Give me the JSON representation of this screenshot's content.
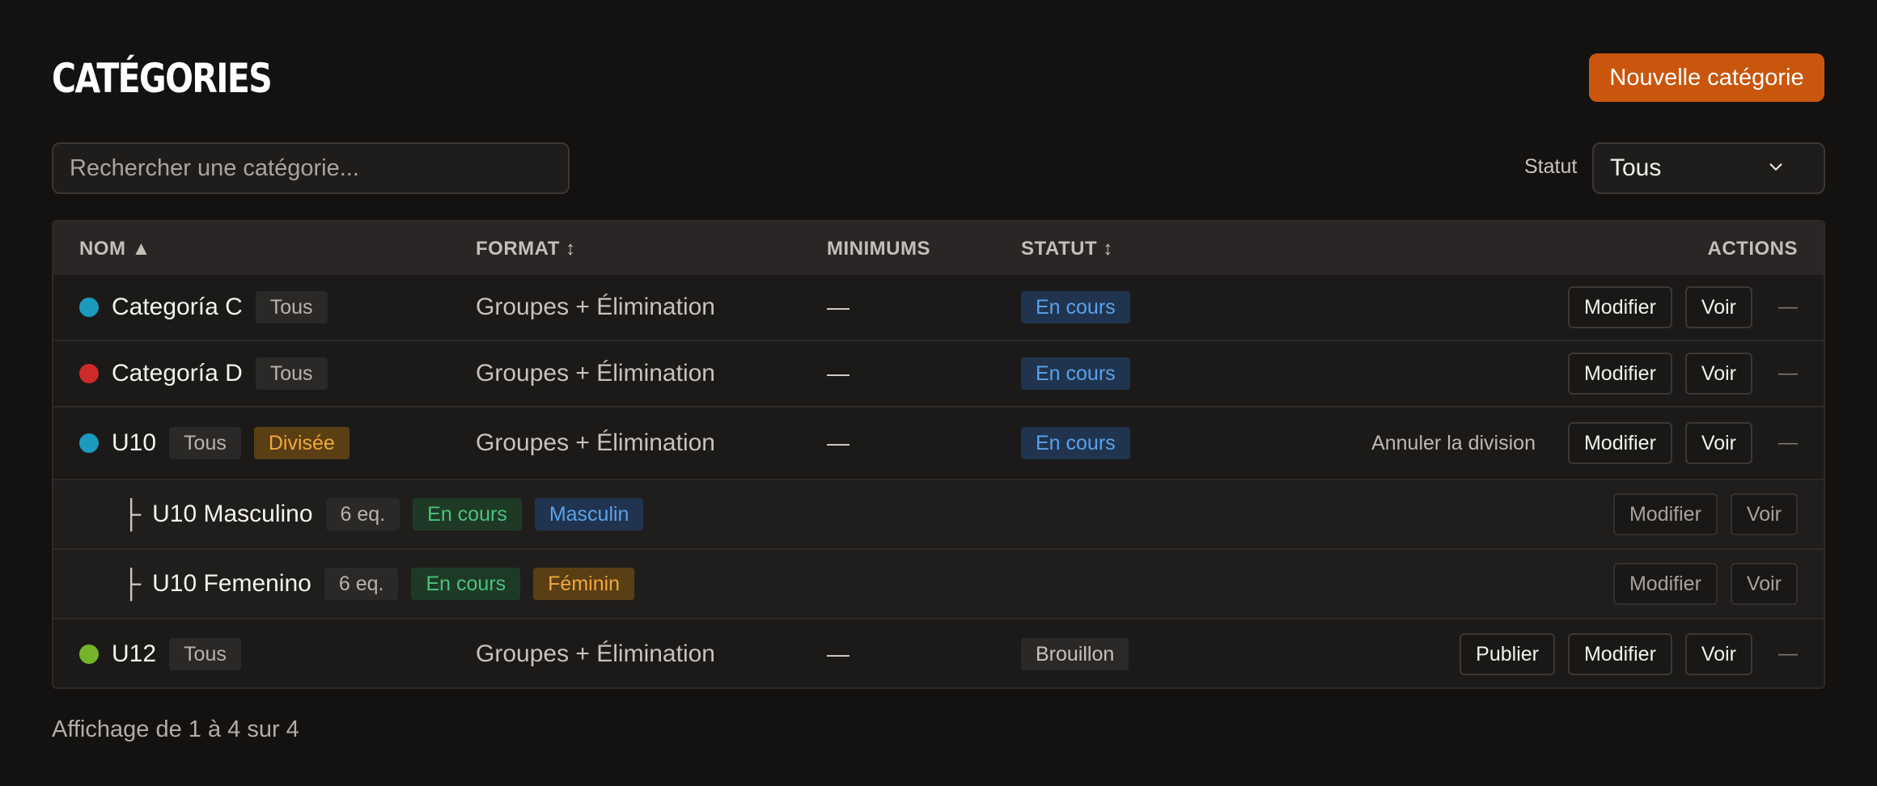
{
  "page": {
    "title": "CATÉGORIES",
    "new_button": "Nouvelle catégorie",
    "search_placeholder": "Rechercher une catégorie...",
    "status_label": "Statut",
    "status_value": "Tous"
  },
  "table": {
    "headers": {
      "name": "NOM ▲",
      "format": "FORMAT ↕",
      "minimums": "MINIMUMS",
      "status": "STATUT ↕",
      "actions": "ACTIONS"
    },
    "rows": [
      {
        "name": "Categoría C",
        "dot_color": "#1a9bbd",
        "gender_tag": "Tous",
        "format": "Groupes + Élimination",
        "minimums": "—",
        "status": "En cours",
        "modify": "Modifier",
        "view": "Voir",
        "extra": "—"
      },
      {
        "name": "Categoría D",
        "dot_color": "#cf2a2a",
        "gender_tag": "Tous",
        "format": "Groupes + Élimination",
        "minimums": "—",
        "status": "En cours",
        "modify": "Modifier",
        "view": "Voir",
        "extra": "—"
      },
      {
        "name": "U10",
        "dot_color": "#1a9bbd",
        "gender_tag": "Tous",
        "divided_tag": "Divisée",
        "format": "Groupes + Élimination",
        "minimums": "—",
        "status": "En cours",
        "cancel_division": "Annuler la division",
        "modify": "Modifier",
        "view": "Voir",
        "extra": "—"
      },
      {
        "name": "U12",
        "dot_color": "#74b32a",
        "gender_tag": "Tous",
        "format": "Groupes + Élimination",
        "minimums": "—",
        "status": "Brouillon",
        "publish": "Publier",
        "modify": "Modifier",
        "view": "Voir",
        "extra": "—"
      }
    ],
    "subrows": [
      {
        "tree": "├",
        "name": "U10 Masculino",
        "teams": "6 eq.",
        "status": "En cours",
        "gender": "Masculin",
        "modify": "Modifier",
        "view": "Voir"
      },
      {
        "tree": "├",
        "name": "U10 Femenino",
        "teams": "6 eq.",
        "status": "En cours",
        "gender": "Féminin",
        "modify": "Modifier",
        "view": "Voir"
      }
    ]
  },
  "footer": {
    "summary": "Affichage de 1 à 4 sur 4"
  },
  "colors": {
    "accent": "#c9560c",
    "background": "#131211"
  }
}
